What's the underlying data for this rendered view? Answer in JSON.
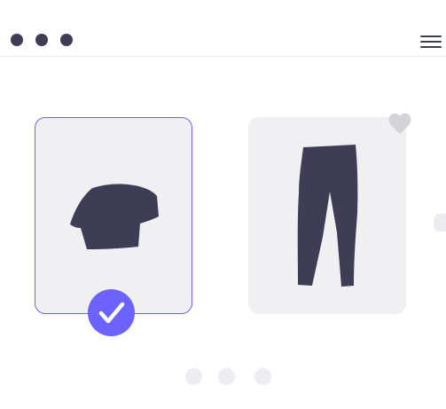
{
  "colors": {
    "accent": "#6c63ff",
    "dark": "#3f3d56",
    "card_bg": "#f0f0f2",
    "heart": "#d4d4d8"
  },
  "window_controls": [
    "dot-icon",
    "dot-icon",
    "dot-icon"
  ],
  "header": {
    "menu_icon": "hamburger-menu-icon"
  },
  "carousel": {
    "items": [
      {
        "name": "shirt",
        "icon": "shirt-icon",
        "selected": true
      },
      {
        "name": "pants",
        "icon": "pants-icon",
        "selected": false,
        "favorite_icon": "heart-icon"
      }
    ],
    "selected_indicator_icon": "checkmark-icon",
    "page_count": 3
  }
}
